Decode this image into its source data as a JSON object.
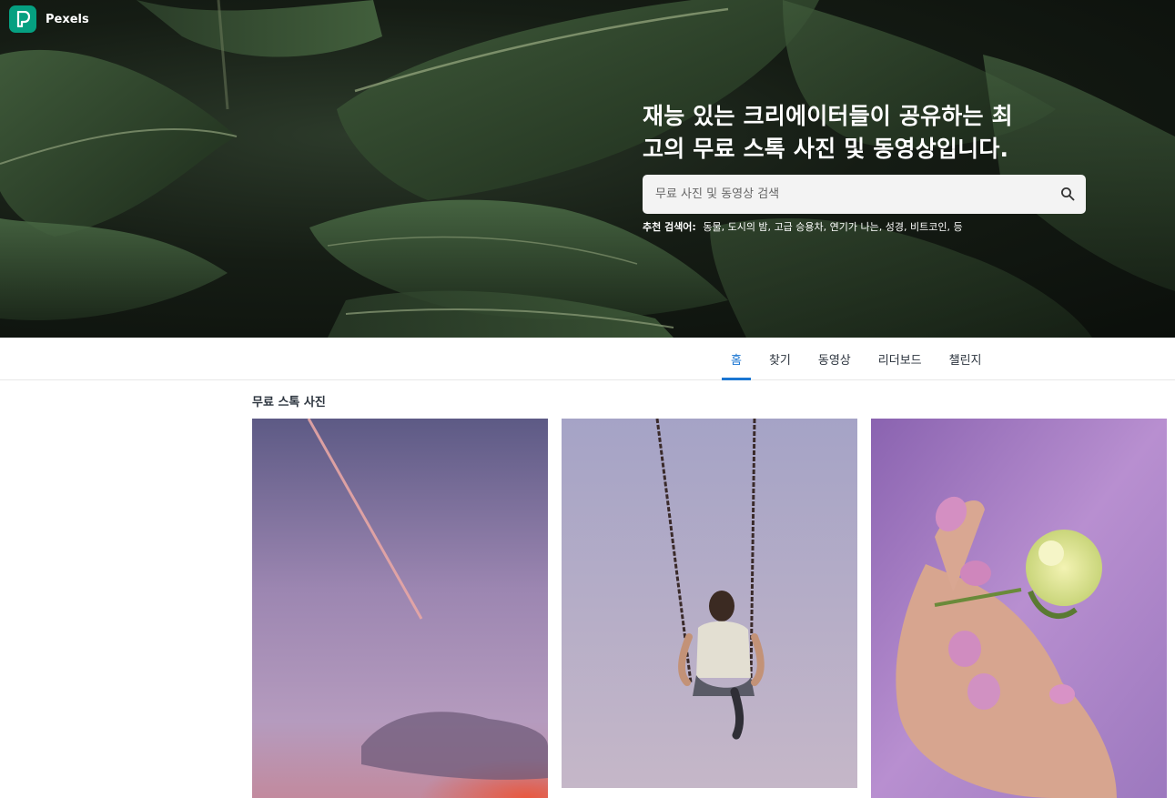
{
  "brand": {
    "name": "Pexels",
    "logo_icon": "pexels-logo-icon",
    "accent": "#05a081"
  },
  "hero": {
    "title_line1": "재능 있는 크리에이터들이 공유하는 최",
    "title_line2": "고의 무료 스톡 사진 및 동영상입니다.",
    "search": {
      "placeholder": "무료 사진 및 동영상 검색",
      "value": "",
      "icon": "search-icon"
    },
    "suggestions_label": "추천 검색어:",
    "suggestions": [
      "동물,",
      "도시의 밤,",
      "고급 승용차,",
      "연기가 나는,",
      "성경,",
      "비트코인,",
      "등"
    ]
  },
  "tabs": [
    {
      "label": "홈",
      "active": true
    },
    {
      "label": "찾기",
      "active": false
    },
    {
      "label": "동영상",
      "active": false
    },
    {
      "label": "리더보드",
      "active": false
    },
    {
      "label": "챌린지",
      "active": false
    }
  ],
  "section": {
    "title": "무료 스톡 사진"
  },
  "colors": {
    "tab_active": "#1a76d2",
    "text": "#2c343e"
  }
}
